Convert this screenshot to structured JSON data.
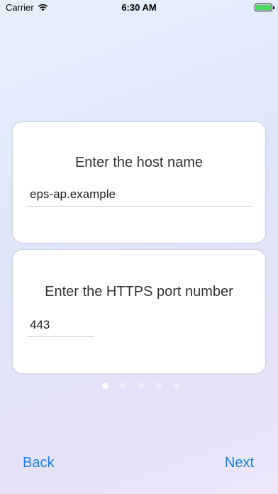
{
  "status_bar": {
    "carrier": "Carrier",
    "time": "6:30 AM",
    "battery_level": 1.0
  },
  "host_card": {
    "title": "Enter the host name",
    "value": "eps-ap.example"
  },
  "port_card": {
    "title": "Enter the HTTPS port number",
    "value": "443"
  },
  "pager": {
    "page_count": 5,
    "current_page": 1
  },
  "footer": {
    "back_label": "Back",
    "next_label": "Next"
  },
  "colors": {
    "accent": "#1a7fd8",
    "battery": "#4cd964"
  }
}
